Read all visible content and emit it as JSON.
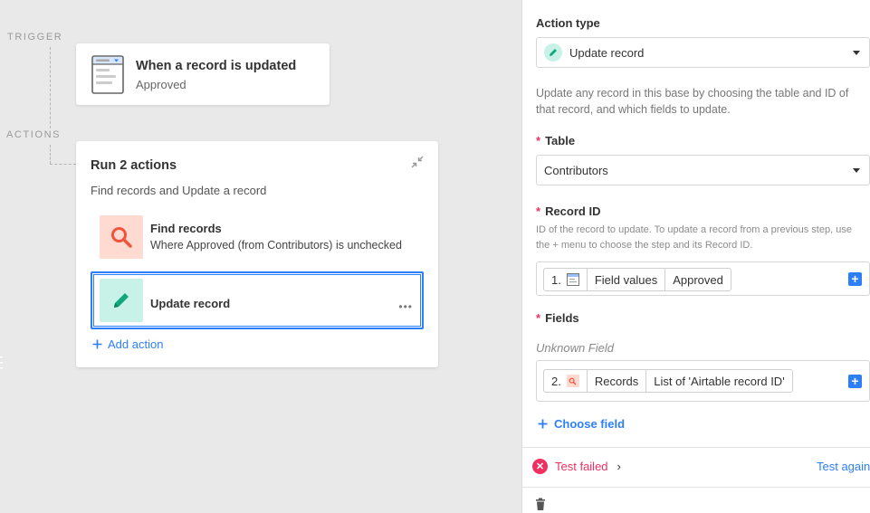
{
  "canvas": {
    "trigger_section_label": "TRIGGER",
    "actions_section_label": "ACTIONS",
    "trigger": {
      "title": "When a record is updated",
      "subtitle": "Approved"
    },
    "actions_group": {
      "title": "Run 2 actions",
      "subtitle": "Find records and Update a record",
      "steps": [
        {
          "title": "Find records",
          "subtitle": "Where Approved (from Contributors) is unchecked",
          "icon": "search-icon",
          "color": "#ffdad1",
          "icon_color": "#f1543a"
        },
        {
          "title": "Update record",
          "icon": "pencil-icon",
          "color": "#c8f2e7",
          "icon_color": "#11a77d",
          "selected": true
        }
      ],
      "add_action_label": "Add action"
    }
  },
  "panel": {
    "action_type_label": "Action type",
    "action_type_value": "Update record",
    "description": "Update any record in this base by choosing the table and ID of that record, and which fields to update.",
    "table_label": "Table",
    "table_value": "Contributors",
    "record_id_label": "Record ID",
    "record_id_help": "ID of the record to update. To update a record from a previous step, use the + menu to choose the step and its Record ID.",
    "record_id_token": {
      "step": "1.",
      "parts": [
        "Field values",
        "Approved"
      ]
    },
    "fields_label": "Fields",
    "unknown_field_label": "Unknown Field",
    "unknown_field_token": {
      "step": "2.",
      "parts": [
        "Records",
        "List of 'Airtable record ID'"
      ]
    },
    "choose_field_label": "Choose field",
    "test_status": "Test failed",
    "test_again_label": "Test again"
  },
  "colors": {
    "accent": "#2d7ff9",
    "error": "#ef3061"
  }
}
